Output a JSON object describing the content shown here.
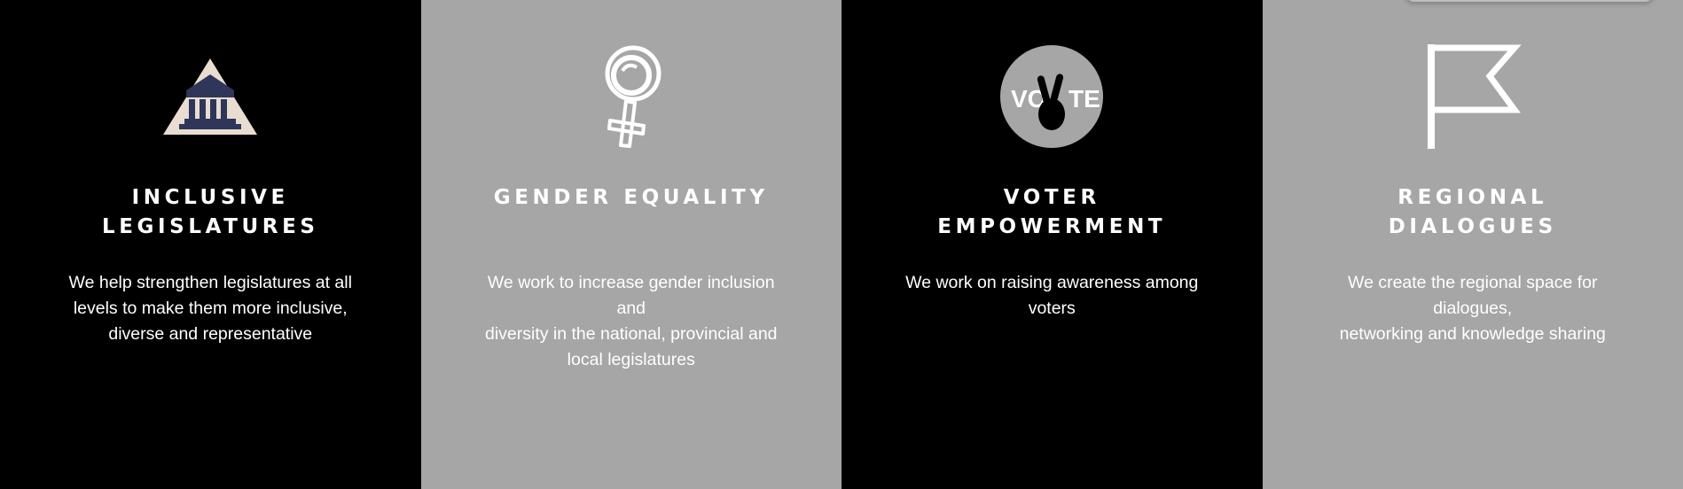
{
  "colors": {
    "dark_panel": "#000000",
    "light_panel": "#a6a6a6",
    "text": "#ffffff",
    "building_navy": "#2f365a",
    "pyramid_beige": "#e8ddd0"
  },
  "cards": [
    {
      "icon": "legislature-building-icon",
      "title": "INCLUSIVE\nLEGISLATURES",
      "description": "We help strengthen legislatures at all\nlevels to make them more inclusive,\ndiverse and representative"
    },
    {
      "icon": "female-symbol-icon",
      "title": "GENDER EQUALITY",
      "description": "We work to increase gender inclusion and\ndiversity in the national, provincial and\nlocal legislatures"
    },
    {
      "icon": "vote-badge-icon",
      "icon_text_left": "VO",
      "icon_text_right": "TE",
      "title": "VOTER\nEMPOWERMENT",
      "description": "We work on raising awareness among voters"
    },
    {
      "icon": "flag-icon",
      "title": "REGIONAL\nDIALOGUES",
      "description": "We create the regional space for dialogues,\nnetworking and knowledge sharing"
    }
  ]
}
